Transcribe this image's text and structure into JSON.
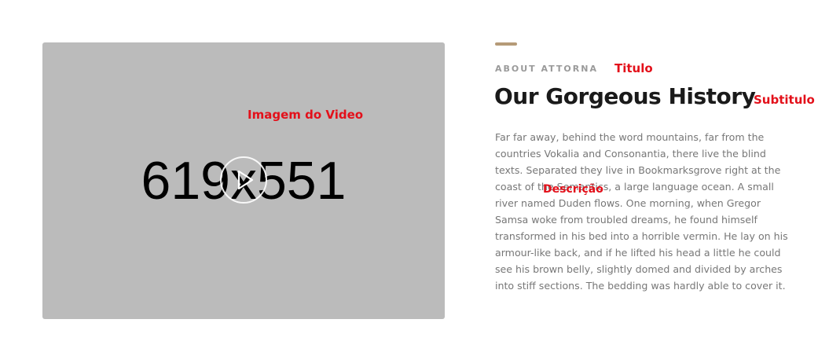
{
  "video": {
    "placeholder_label": "619x551",
    "play_icon": "play-icon"
  },
  "section": {
    "accent_color": "#b59a77",
    "eyebrow": "ABOUT ATTORNA",
    "heading": "Our Gorgeous History",
    "description": "Far far away, behind the word mountains, far from the countries Vokalia and Consonantia, there live the blind texts. Separated they live in Bookmarksgrove right at the coast of the Semantics, a large language ocean. A small river named Duden flows. One morning, when Gregor Samsa woke from troubled dreams, he found himself transformed in his bed into a horrible vermin. He lay on his armour-like back, and if he lifted his head a little he could see his brown belly, slightly domed and divided by arches into stiff sections. The bedding was hardly able to cover it."
  },
  "annotations": {
    "video_image": "Imagem do Video",
    "title": "Titulo",
    "subtitle": "Subtitulo",
    "description": "Descrição",
    "color": "#e3101a"
  }
}
